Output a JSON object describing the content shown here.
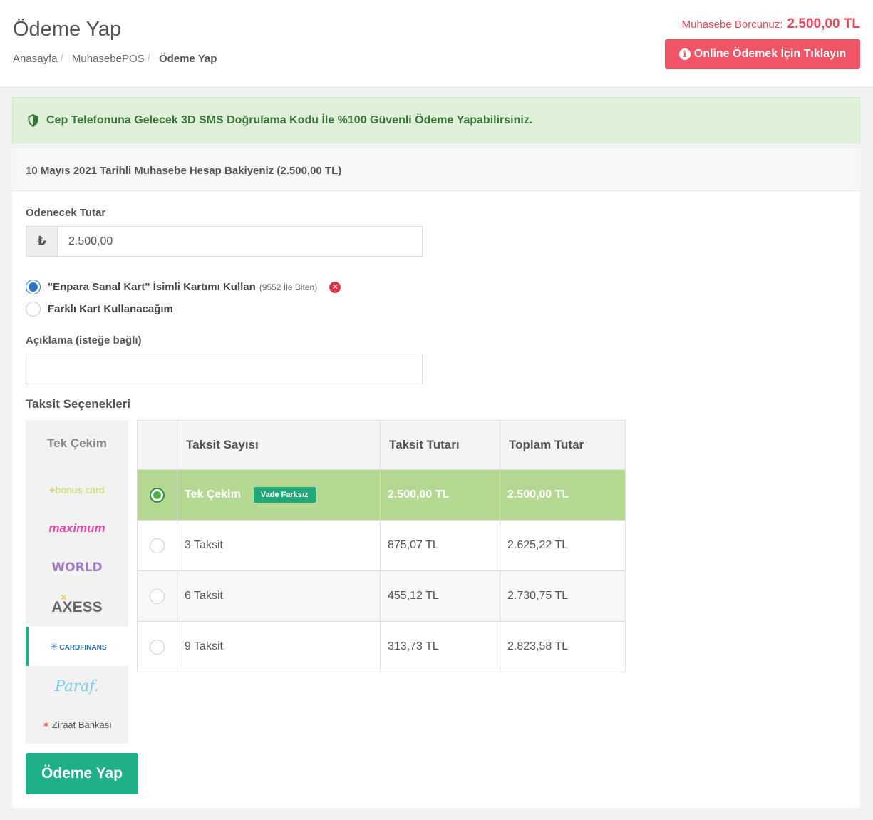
{
  "header": {
    "title": "Ödeme Yap",
    "breadcrumb": [
      "Anasayfa",
      "MuhasebePOS",
      "Ödeme Yap"
    ],
    "debt_label": "Muhasebe Borcunuz:",
    "debt_amount": "2.500,00 TL",
    "online_button": "Online Ödemek İçin Tıklayın"
  },
  "alert": {
    "text": "Cep Telefonuna Gelecek 3D SMS Doğrulama Kodu İle %100 Güvenli Ödeme Yapabilirsiniz."
  },
  "panel": {
    "heading": "10 Mayıs 2021 Tarihli Muhasebe Hesap Bakiyeniz (2.500,00 TL)"
  },
  "form": {
    "amount_label": "Ödenecek Tutar",
    "currency_symbol": "₺",
    "amount_value": "2.500,00",
    "saved_card_label": "\"Enpara Sanal Kart\" İsimli Kartımı Kullan",
    "saved_card_suffix": "(9552 İle Biten)",
    "other_card_label": "Farklı Kart Kullanacağım",
    "description_label": "Açıklama (isteğe bağlı)",
    "description_value": ""
  },
  "installments": {
    "title": "Taksit Seçenekleri",
    "banks": [
      "Tek Çekim",
      "bonus card",
      "maximum",
      "WORLD",
      "AXESS",
      "CARDFINANS",
      "Paraf.",
      "Ziraat Bankası"
    ],
    "active_bank": "CARDFINANS",
    "headers": [
      "Taksit Sayısı",
      "Taksit Tutarı",
      "Toplam Tutar"
    ],
    "rows": [
      {
        "count": "Tek Çekim",
        "badge": "Vade Farksız",
        "installment": "2.500,00 TL",
        "total": "2.500,00 TL"
      },
      {
        "count": "3 Taksit",
        "installment": "875,07 TL",
        "total": "2.625,22 TL"
      },
      {
        "count": "6 Taksit",
        "installment": "455,12 TL",
        "total": "2.730,75 TL"
      },
      {
        "count": "9 Taksit",
        "installment": "313,73 TL",
        "total": "2.823,58 TL"
      }
    ]
  },
  "submit_button": "Ödeme Yap",
  "colors": {
    "primary": "#1fb08a",
    "danger": "#ef5566",
    "selected_row": "#b5d993",
    "alert_bg": "#dff0d8"
  }
}
